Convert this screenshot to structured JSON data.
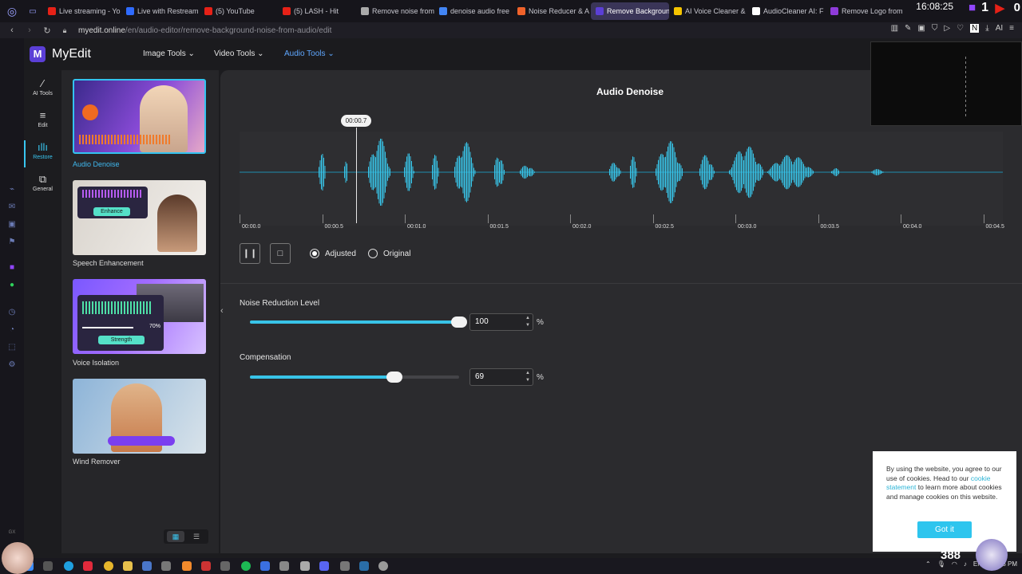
{
  "browser": {
    "tabs": [
      {
        "title": "Live streaming - Yo",
        "color": "#e62117"
      },
      {
        "title": "Live with Restream",
        "color": "#2f6bff"
      },
      {
        "title": "(5) YouTube",
        "color": "#e62117"
      },
      {
        "title": "(5) LASH - Hit",
        "color": "#e62117"
      },
      {
        "title": "Remove noise from",
        "color": "#aaaaaa"
      },
      {
        "title": "denoise audio free",
        "color": "#4285f4"
      },
      {
        "title": "Noise Reducer & A",
        "color": "#f0622a"
      },
      {
        "title": "Remove Background N",
        "color": "#5b3fd6",
        "active": true
      },
      {
        "title": "AI Voice Cleaner &",
        "color": "#f5c400"
      },
      {
        "title": "AudioCleaner AI: F",
        "color": "#ffffff"
      },
      {
        "title": "Remove Logo from",
        "color": "#8e3bd9"
      }
    ],
    "clock": "16:08:25",
    "tray_count": "1",
    "notif_count": "0",
    "url_host": "myedit.online",
    "url_path": "/en/audio-editor/remove-background-noise-from-audio/edit"
  },
  "app": {
    "logo": "MyEdit",
    "logo_mark": "M",
    "menus": {
      "image": "Image Tools",
      "video": "Video Tools",
      "audio": "Audio Tools"
    },
    "rail": {
      "ai": "AI Tools",
      "edit": "Edit",
      "restore": "Restore",
      "general": "General"
    },
    "cards": {
      "denoise": "Audio Denoise",
      "speech": "Speech Enhancement",
      "speech_pill": "Enhance",
      "isolation": "Voice Isolation",
      "isolation_pct": "70%",
      "isolation_pill": "Strength",
      "wind": "Wind Remover"
    }
  },
  "editor": {
    "title": "Audio Denoise",
    "playhead_time": "00:00.7",
    "ticks": [
      "00:00.0",
      "00:00.5",
      "00:01.0",
      "00:01.5",
      "00:02.0",
      "00:02.5",
      "00:03.0",
      "00:03.5",
      "00:04.0",
      "00:04.5"
    ],
    "mode_adjusted": "Adjusted",
    "mode_original": "Original",
    "noise_label": "Noise Reduction Level",
    "noise_value": "100",
    "noise_level": 1.0,
    "comp_label": "Compensation",
    "comp_value": "69",
    "comp_level": 0.69,
    "unit": "%",
    "accent": "#38c4e8"
  },
  "cookie": {
    "text1": "By using the website, you agree to our use of cookies. Head to our",
    "link": "cookie statement",
    "text2": "to learn more about cookies and manage cookies on this website.",
    "button": "Got it"
  },
  "system": {
    "count": "388",
    "lang": "ENG",
    "time": "4:08 PM"
  }
}
